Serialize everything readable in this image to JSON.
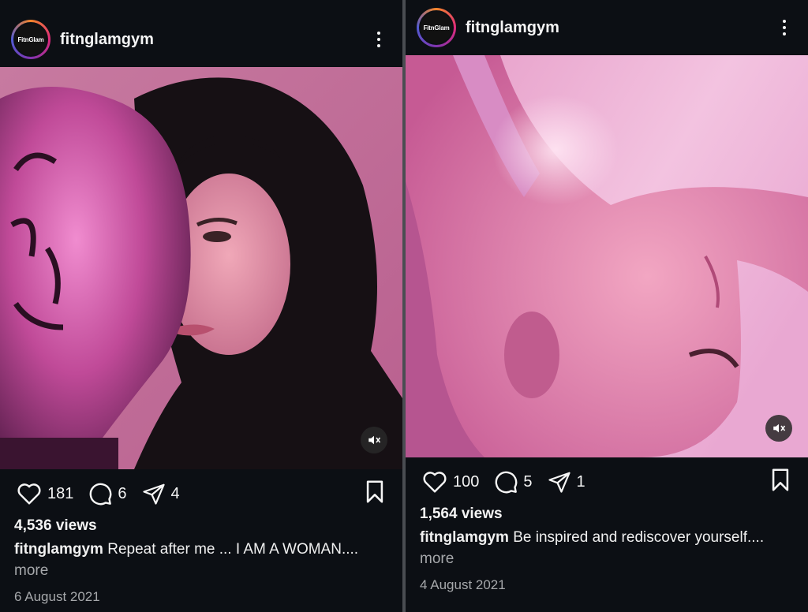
{
  "posts": [
    {
      "username": "fitnglamgym",
      "avatar_text": "FitnGlam",
      "likes": "181",
      "comments": "6",
      "shares": "4",
      "views": "4,536 views",
      "caption_user": "fitnglamgym",
      "caption_text": "Repeat after me ... I AM A WOMAN....",
      "more": "more",
      "date": "6 August 2021",
      "muted": true
    },
    {
      "username": "fitnglamgym",
      "avatar_text": "FitnGlam",
      "likes": "100",
      "comments": "5",
      "shares": "1",
      "views": "1,564 views",
      "caption_user": "fitnglamgym",
      "caption_text": "Be inspired and rediscover yourself....",
      "more": "more",
      "date": "4 August 2021",
      "muted": true
    }
  ],
  "colors": {
    "background": "#0c0f14",
    "text": "#f5f5f5",
    "muted_text": "#a6a8ab",
    "media_pink": "#d05a9c"
  },
  "icons": [
    "heart-icon",
    "comment-icon",
    "share-icon",
    "bookmark-icon",
    "more-options-icon",
    "muted-audio-icon"
  ]
}
